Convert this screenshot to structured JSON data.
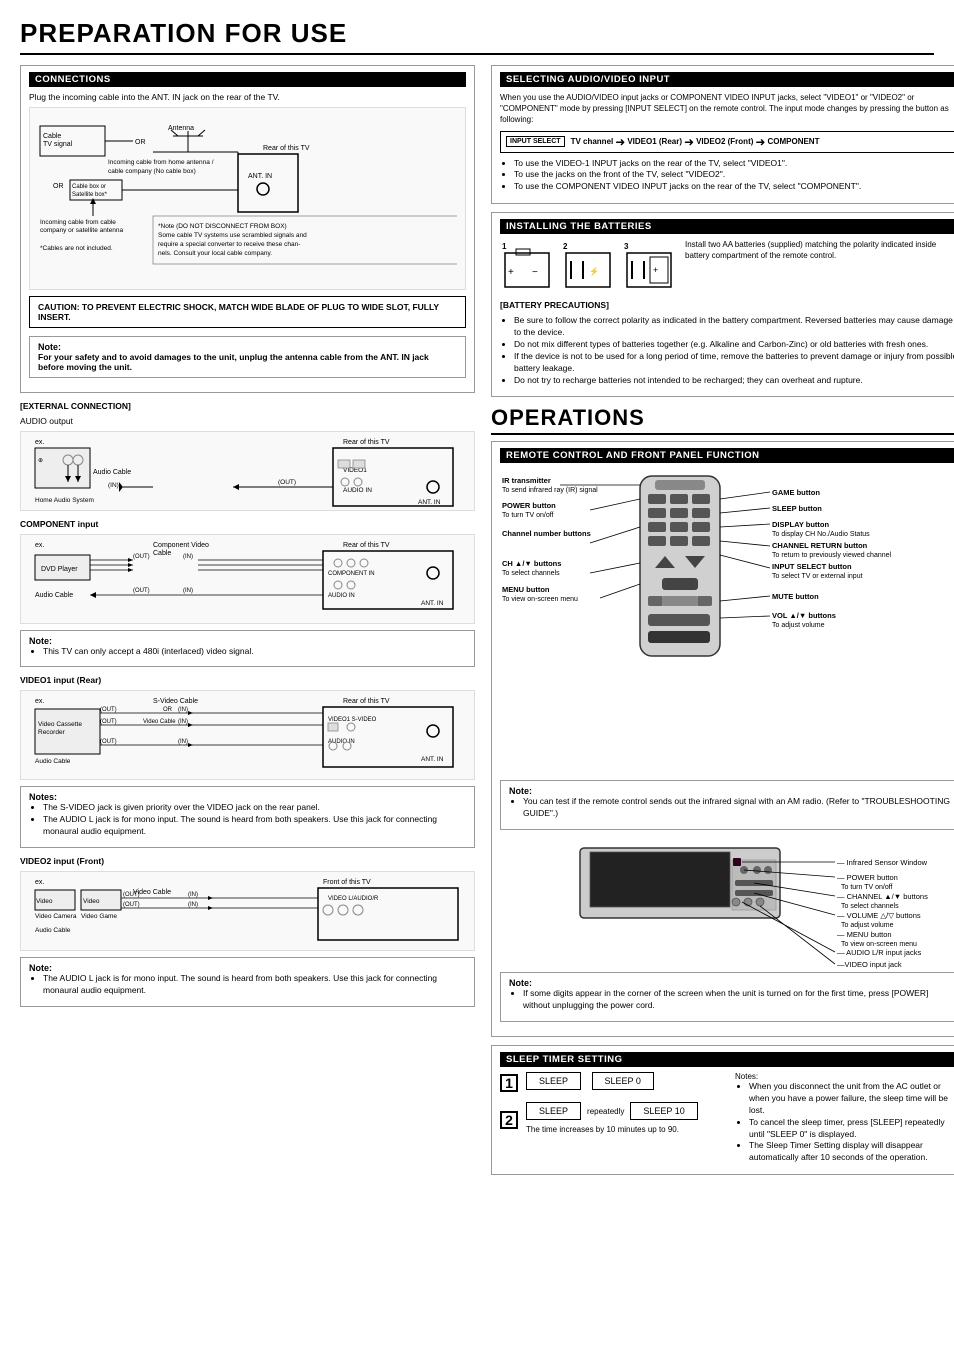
{
  "title": "PREPARATION FOR USE",
  "operations_title": "OPERATIONS",
  "sections": {
    "connections": {
      "header": "CONNECTIONS",
      "intro": "Plug the incoming cable into the ANT. IN jack on the rear of the TV.",
      "labels": {
        "cable_tv": "Cable TV signal",
        "or1": "OR",
        "antenna": "Antenna",
        "incoming_home": "Incoming cable from home antenna / cable company (No cable box)",
        "or2": "OR",
        "cable_box": "Cable box or Satellite box*",
        "rear_tv": "Rear of this TV",
        "ant_in": "ANT. IN",
        "incoming_cable": "Incoming cable from cable company or satellite antenna",
        "cables_note": "*Cables are not included.",
        "note_box": "*Note (DO NOT DISCONNECT FROM BOX) Some cable TV systems use scrambled signals and require a special converter to receive these channels. Consult your local cable company."
      },
      "caution": "CAUTION: TO PREVENT ELECTRIC SHOCK, MATCH WIDE BLADE OF PLUG TO WIDE SLOT, FULLY INSERT.",
      "safety_note": "For your safety and to avoid damages to the unit, unplug the antenna cable from the ANT. IN jack before moving the unit."
    },
    "external_connection": {
      "header": "[EXTERNAL CONNECTION]",
      "subtitle": "AUDIO output",
      "labels": {
        "ex": "ex.",
        "audio_cable": "Audio Cable",
        "in": "(IN)",
        "out": "(OUT)",
        "rear_tv": "Rear of this TV",
        "home_audio": "Home Audio System"
      }
    },
    "component_input": {
      "header": "COMPONENT input",
      "labels": {
        "component_video_cable": "Component Video Cable",
        "ex": "ex.",
        "out": "(OUT)",
        "in": "(IN)",
        "rear_tv": "Rear of this TV",
        "dvd_player": "DVD Player",
        "audio_cable": "Audio Cable"
      },
      "note": "This TV can only accept a 480i (interlaced) video signal."
    },
    "video1_input": {
      "header": "VIDEO1 input (Rear)",
      "labels": {
        "s_video_cable": "S-Video Cable",
        "ex": "ex.",
        "or": "OR",
        "out": "(OUT)",
        "in": "(IN)",
        "rear_tv": "Rear of this TV",
        "video_cable": "Video Cable",
        "audio_cable": "Audio Cable",
        "video_cassette": "Video Cassette Recorder"
      },
      "notes": [
        "The S-VIDEO jack is given priority over the VIDEO jack on the rear panel.",
        "The AUDIO L jack is for mono input. The sound is heard from both speakers. Use this jack for connecting monaural audio equipment."
      ]
    },
    "video2_input": {
      "header": "VIDEO2 input (Front)",
      "labels": {
        "front_tv": "Front of this TV",
        "ex": "ex.",
        "video_cable": "Video Cable",
        "out": "(OUT)",
        "in": "(IN)",
        "audio_cable": "Audio Cable",
        "video_camera": "Video Camera",
        "video_game": "Video Game"
      },
      "note": "The AUDIO L jack is for mono input. The sound is heard from both speakers. Use this jack for connecting monaural audio equipment."
    },
    "selecting_audio_video": {
      "header": "SELECTING AUDIO/VIDEO INPUT",
      "intro": "When you use the AUDIO/VIDEO input jacks or COMPONENT VIDEO INPUT jacks, select \"VIDEO1\" or \"VIDEO2\" or \"COMPONENT\" mode by pressing [INPUT SELECT] on the remote control. The input mode changes by pressing the button as following:",
      "input_select_label": "INPUT SELECT",
      "flow": [
        "TV channel",
        "VIDEO1 (Rear)",
        "VIDEO2 (Front)",
        "COMPONENT"
      ],
      "bullets": [
        "To use the VIDEO-1 INPUT jacks on the rear of the TV, select \"VIDEO1\".",
        "To use the jacks on the front of the TV, select \"VIDEO2\".",
        "To use the COMPONENT VIDEO INPUT jacks on the rear of the TV, select \"COMPONENT\"."
      ]
    },
    "installing_batteries": {
      "header": "INSTALLING THE BATTERIES",
      "instruction": "Install two AA batteries (supplied) matching the polarity indicated inside battery compartment of the remote control.",
      "precautions_header": "[BATTERY PRECAUTIONS]",
      "precautions": [
        "Be sure to follow the correct polarity as indicated in the battery compartment. Reversed batteries may cause damage to the device.",
        "Do not mix different types of batteries together (e.g. Alkaline and Carbon-Zinc) or old batteries with fresh ones.",
        "If the device is not to be used for a long period of time, remove the batteries to prevent damage or injury from possible battery leakage.",
        "Do not try to recharge batteries not intended to be recharged; they can overheat and rupture."
      ]
    },
    "remote_control": {
      "header": "REMOTE CONTROL AND FRONT PANEL FUNCTION",
      "elements": {
        "ir_transmitter": "IR transmitter",
        "ir_sub": "To send infrared ray (IR) signal",
        "power_button": "POWER button",
        "power_sub": "To turn TV on/off",
        "channel_number_buttons": "Channel number buttons",
        "ch_buttons": "CH ▲/▼ buttons",
        "ch_sub": "To select channels",
        "menu_button": "MENU button",
        "menu_sub": "To view on-screen menu",
        "game_button": "GAME button",
        "sleep_button": "SLEEP button",
        "display_button": "DISPLAY button",
        "display_sub": "To display CH No./Audio Status",
        "channel_return_button": "CHANNEL RETURN button",
        "channel_return_sub": "To return to previously viewed channel",
        "input_select_button": "INPUT SELECT button",
        "input_select_sub": "To select TV or external input",
        "mute_button": "MUTE button",
        "vol_buttons": "VOL ▲/▼ buttons",
        "vol_sub": "To adjust volume"
      },
      "note": "You can test if the remote control sends out the infrared signal with an AM radio. (Refer to \"TROUBLESHOOTING GUIDE\".)"
    },
    "front_panel": {
      "elements": {
        "infrared_sensor": "Infrared Sensor Window",
        "power_button": "POWER button",
        "power_sub": "To turn TV on/off",
        "channel_buttons": "CHANNEL ▲/▼ buttons",
        "channel_sub": "To select channels",
        "volume_buttons": "VOLUME △/▽ buttons",
        "volume_sub": "To adjust volume",
        "menu_button": "MENU button",
        "menu_sub": "To view on-screen menu",
        "audio_lr": "AUDIO L/R input jacks",
        "video_input": "VIDEO input jack"
      },
      "note": "If some digits appear in the corner of the screen when the unit is turned on for the first time, press [POWER] without unplugging the power cord."
    },
    "sleep_timer": {
      "header": "SLEEP TIMER SETTING",
      "step1_num": "1",
      "step1_label": "SLEEP",
      "step1_display": "SLEEP 0",
      "step2_num": "2",
      "step2_label": "SLEEP",
      "step2_sub": "repeatedly",
      "step2_display": "SLEEP 10",
      "step2_desc": "The time increases by 10 minutes up to 90.",
      "notes": [
        "When you disconnect the unit from the AC outlet or when you have a power failure, the sleep time will be lost.",
        "To cancel the sleep timer, press [SLEEP] repeatedly until \"SLEEP 0\" is displayed.",
        "The Sleep Timer Setting display will disappear automatically after 10 seconds of the operation."
      ]
    }
  }
}
